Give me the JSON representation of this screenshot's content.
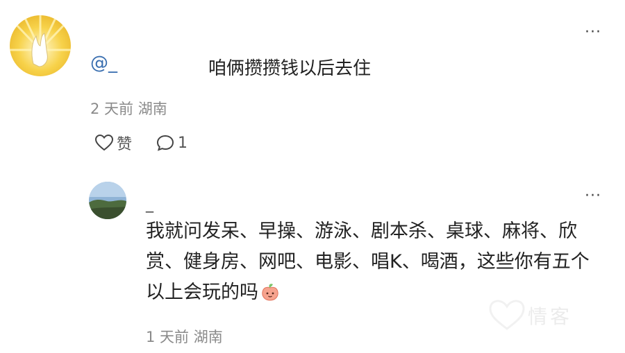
{
  "comment": {
    "mention": "@_",
    "text": "咱俩攒攒钱以后去住",
    "meta": "2 天前 湖南",
    "like_label": "赞",
    "reply_count": "1",
    "more_label": "···"
  },
  "reply": {
    "author": "_",
    "text": "我就问发呆、早操、游泳、剧本杀、桌球、麻将、欣赏、健身房、网吧、电影、唱K、喝酒，这些你有五个以上会玩的吗",
    "meta": "1 天前 湖南",
    "more_label": "···"
  },
  "watermark": {
    "text": "情客"
  },
  "colors": {
    "link": "#3a6fb0",
    "meta": "#8a8a8a",
    "background": "#ffffff"
  }
}
